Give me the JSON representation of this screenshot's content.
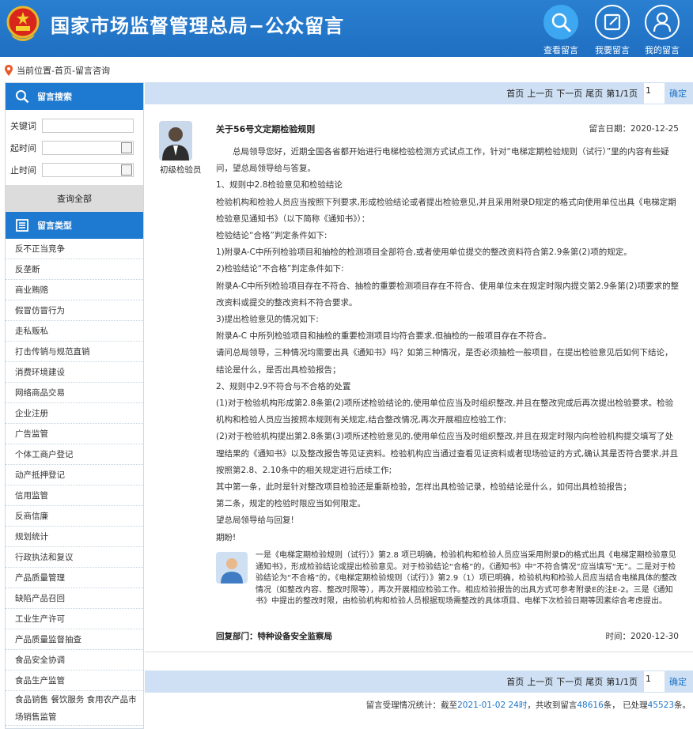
{
  "header": {
    "title": "国家市场监督管理总局−公众留言",
    "buttons": [
      {
        "label": "查看留言",
        "icon": "search-icon"
      },
      {
        "label": "我要留言",
        "icon": "compose-icon"
      },
      {
        "label": "我的留言",
        "icon": "user-icon"
      }
    ]
  },
  "breadcrumb": "当前位置-首页-留言咨询",
  "sidebar": {
    "search_title": "留言搜索",
    "keyword_label": "关键词",
    "start_label": "起时间",
    "end_label": "止时间",
    "query_all": "查询全部",
    "category_title": "留言类型",
    "categories": [
      "反不正当竞争",
      "反垄断",
      "商业贿赂",
      "假冒仿冒行为",
      "走私贩私",
      "打击传销与规范直销",
      "消费环境建设",
      "网络商品交易",
      "企业注册",
      "广告监管",
      "个体工商户登记",
      "动产抵押登记",
      "信用监管",
      "反商信廉",
      "规划统计",
      "行政执法和复议",
      "产品质量管理",
      "缺陷产品召回",
      "工业生产许可",
      "产品质量监督抽查",
      "食品安全协调",
      "食品生产监管",
      "食品销售 餐饮服务 食用农产品市场销售监管"
    ]
  },
  "pager": {
    "first": "首页",
    "prev": "上一页",
    "next": "下一页",
    "last": "尾页",
    "page_info": "第1/1页",
    "page_value": "1",
    "go": "确定"
  },
  "message": {
    "user_role": "初级检验员",
    "title": "关于56号文定期检验规则",
    "date": "留言日期：2020-12-25",
    "body": [
      "总局领导您好，近期全国各省都开始进行电梯检验检测方式试点工作，针对“电梯定期检验规则（试行）”里的内容有些疑问，望总局领导给与答复。",
      "1、规则中2.8检验意见和检验结论",
      "检验机构和检验人员应当按照下列要求,形成检验结论或者提出检验意见,并且采用附录D规定的格式向使用单位出具《电梯定期检验意见通知书》（以下简称《通知书》）：",
      "检验结论“合格”判定条件如下:",
      "1)附录A-C中所列检验项目和抽检的检测项目全部符合,或者使用单位提交的整改资料符合第2.9条第(2)项的规定。",
      "2)检验结论“不合格”判定条件如下:",
      "附录A-C中所列检验项目存在不符合、抽检的重要检测项目存在不符合、使用单位未在规定时限内提交第2.9条第(2)项要求的整改资料或提交的整改资料不符合要求。",
      "3)提出检验意见的情况如下:",
      "附录A-C 中所列检验项目和抽检的重要检测项目均符合要求,但抽检的一般项目存在不符合。",
      "请问总局领导，三种情况均需要出具《通知书》吗？如第三种情况，是否必须抽检一般项目，在提出检验意见后如何下结论，结论是什么，是否出具检验报告；",
      "2、规则中2.9不符合与不合格的处置",
      "(1)对于检验机构形成第2.8条第(2)项所述检验结论的,使用单位应当及时组织整改,并且在整改完成后再次提出检验要求。检验机构和检验人员应当按照本规则有关规定,结合整改情况,再次开展相应检验工作;",
      "(2)对于检验机构提出第2.8条第(3)项所述检验意见的,使用单位应当及时组织整改,并且在规定时限内向检验机构提交填写了处理结果的《通知书》以及整改报告等见证资料。检验机构应当通过查看见证资料或者现场验证的方式,确认其是否符合要求,并且按照第2.8、2.10条中的相关规定进行后续工作;",
      "其中第一条，此时是针对整改项目检验还是重新检验，怎样出具检验记录，检验结论是什么，如何出具检验报告；",
      "第二条，规定的检验时限应当如何限定。",
      "望总局领导给与回复!",
      "期盼!"
    ]
  },
  "reply": {
    "text": "一是《电梯定期检验规则（试行）》第2.8 项已明确，检验机构和检验人员应当采用附录D的格式出具《电梯定期检验意见通知书》，形成检验结论或提出检验意见。对于检验结论“合格”的，《通知书》中“不符合情况”应当填写“无”。二是对于检验结论为“不合格”的，《电梯定期检验规则（试行）》第2.9（1）项已明确，检验机构和检验人员应当结合电梯具体的整改情况（如整改内容、整改时限等），再次开展相应检验工作。相应检验报告的出具方式可参考附录E的注E-2。三是《通知书》中提出的整改时限，由检验机构和检验人员根据现场需整改的具体项目、电梯下次检验日期等因素综合考虑提出。",
    "dept": "回复部门：特种设备安全监察局",
    "time": "时间：2020-12-30"
  },
  "stats": {
    "prefix": "留言受理情况统计：截至",
    "date": "2021-01-02 24时",
    "mid1": "，共收到留言",
    "received": "48616",
    "mid2": "条，   已处理",
    "processed": "45523",
    "suffix": "条。"
  },
  "colors": {
    "header_blue": "#1f6fc2",
    "accent_blue": "#1e7ad0",
    "pager_bg": "#cfe0f4",
    "link_blue": "#1b74c9"
  }
}
